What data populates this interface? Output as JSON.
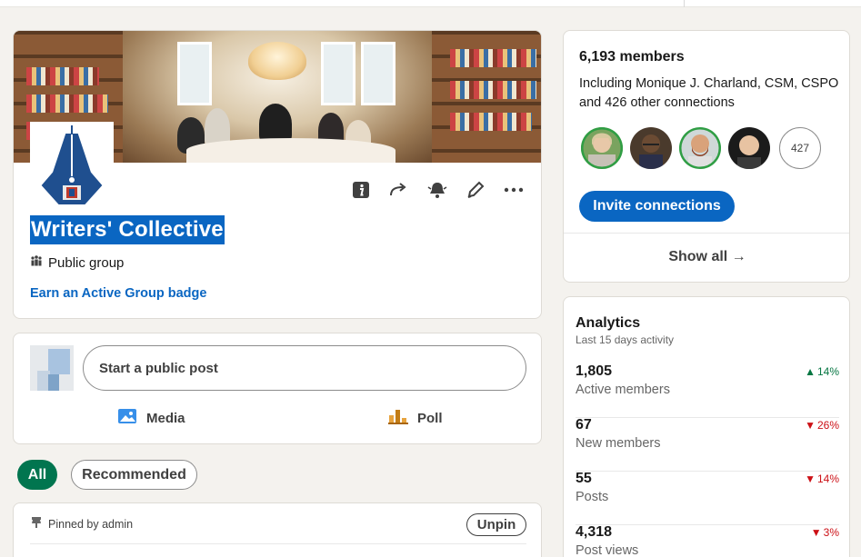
{
  "group": {
    "title": "Writers' Collective",
    "type_label": "Public group",
    "badge_link": "Earn an Active Group badge"
  },
  "composer": {
    "placeholder": "Start a public post",
    "media_label": "Media",
    "poll_label": "Poll"
  },
  "filters": {
    "all_label": "All",
    "recommended_label": "Recommended"
  },
  "pinned": {
    "label": "Pinned by admin",
    "unpin_label": "Unpin"
  },
  "members": {
    "count_text": "6,193 members",
    "description": "Including Monique J. Charland, CSM, CSPO and 426 other connections",
    "more_count": "427",
    "invite_label": "Invite connections",
    "show_all_label": "Show all →"
  },
  "analytics": {
    "title": "Analytics",
    "subtitle": "Last 15 days activity",
    "rows": [
      {
        "value": "1,805",
        "label": "Active members",
        "change": "14%",
        "direction": "up"
      },
      {
        "value": "67",
        "label": "New members",
        "change": "26%",
        "direction": "down"
      },
      {
        "value": "55",
        "label": "Posts",
        "change": "14%",
        "direction": "down"
      },
      {
        "value": "4,318",
        "label": "Post views",
        "change": "3%",
        "direction": "down"
      }
    ]
  },
  "icons": {
    "info": "info-icon",
    "share": "share-icon",
    "notifications": "bell-icon",
    "edit": "pencil-icon",
    "more": "more-icon",
    "people": "people-icon",
    "media": "image-icon",
    "poll": "poll-icon",
    "pin": "pin-icon",
    "up": "▲",
    "down": "▼"
  },
  "colors": {
    "brand_blue": "#0a66c2",
    "active_green": "#01754f",
    "trend_up": "#057642",
    "trend_down": "#cc1016"
  }
}
